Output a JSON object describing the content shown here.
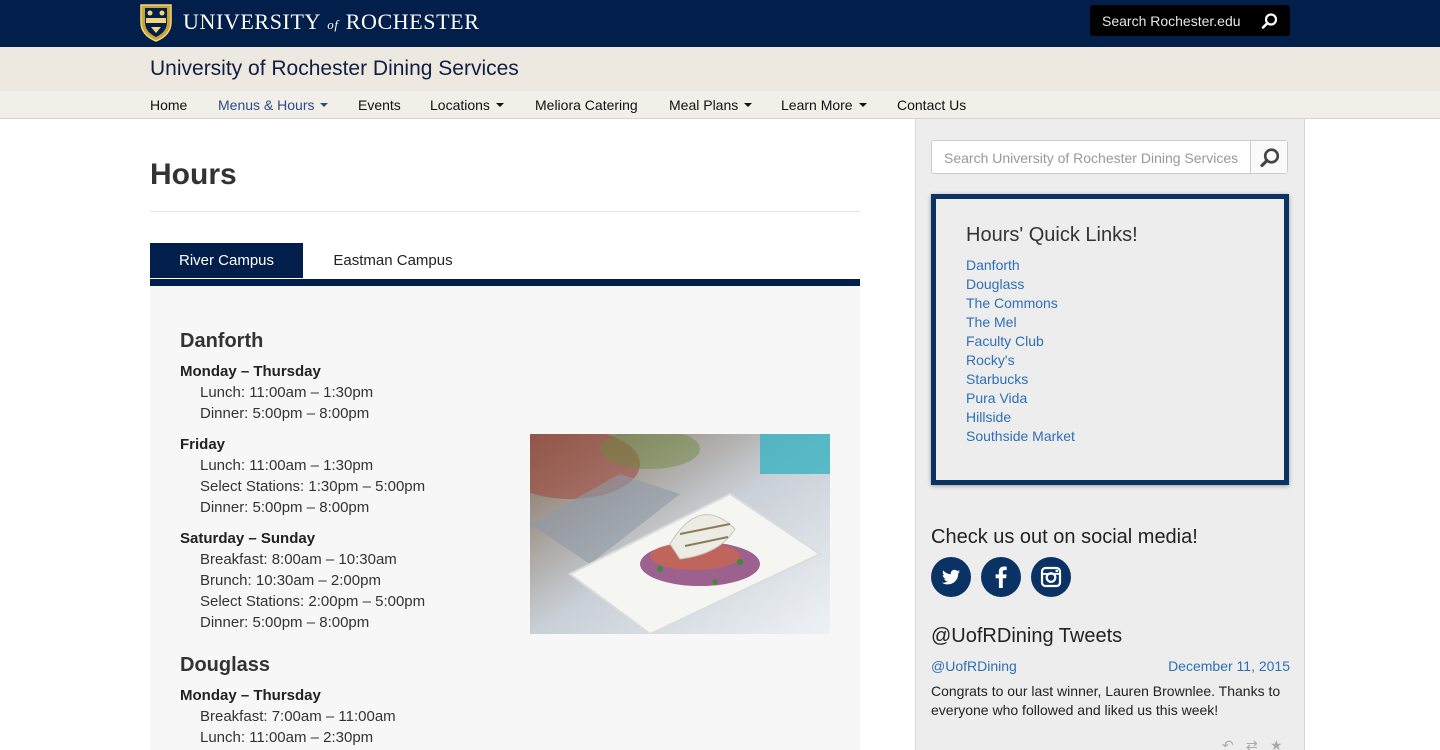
{
  "header": {
    "brand_main": "UNIVERSITY",
    "brand_of": "of",
    "brand_end": "ROCHESTER",
    "search_placeholder": "Search Rochester.edu"
  },
  "site_title": "University of Rochester Dining Services",
  "nav": {
    "items": [
      {
        "label": "Home",
        "dropdown": false,
        "active": false
      },
      {
        "label": "Menus & Hours",
        "dropdown": true,
        "active": true
      },
      {
        "label": "Events",
        "dropdown": false,
        "active": false
      },
      {
        "label": "Locations",
        "dropdown": true,
        "active": false
      },
      {
        "label": "Meliora Catering",
        "dropdown": false,
        "active": false
      },
      {
        "label": "Meal Plans",
        "dropdown": true,
        "active": false
      },
      {
        "label": "Learn More",
        "dropdown": true,
        "active": false
      },
      {
        "label": "Contact Us",
        "dropdown": false,
        "active": false
      }
    ]
  },
  "page": {
    "title": "Hours",
    "tabs": [
      {
        "label": "River Campus",
        "active": true
      },
      {
        "label": "Eastman Campus",
        "active": false
      }
    ]
  },
  "locations": [
    {
      "name": "Danforth",
      "schedule": [
        {
          "days": "Monday – Thursday",
          "meals": [
            "Lunch: 11:00am – 1:30pm",
            "Dinner: 5:00pm – 8:00pm"
          ]
        },
        {
          "days": "Friday",
          "meals": [
            "Lunch: 11:00am – 1:30pm",
            "Select Stations: 1:30pm – 5:00pm",
            "Dinner: 5:00pm – 8:00pm"
          ]
        },
        {
          "days": "Saturday – Sunday",
          "meals": [
            "Breakfast: 8:00am – 10:30am",
            "Brunch: 10:30am – 2:00pm",
            "Select Stations: 2:00pm – 5:00pm",
            "Dinner: 5:00pm – 8:00pm"
          ]
        }
      ]
    },
    {
      "name": "Douglass",
      "schedule": [
        {
          "days": "Monday – Thursday",
          "meals": [
            "Breakfast: 7:00am – 11:00am",
            "Lunch: 11:00am – 2:30pm"
          ]
        }
      ]
    }
  ],
  "sidebar": {
    "search_placeholder": "Search University of Rochester Dining Services",
    "quick_links_title": "Hours' Quick Links!",
    "quick_links": [
      "Danforth",
      "Douglass",
      "The Commons",
      "The Mel",
      "Faculty Club",
      "Rocky's",
      "Starbucks",
      "Pura Vida",
      "Hillside",
      "Southside Market"
    ],
    "social_title": "Check us out on social media!",
    "social_icons": [
      "twitter-icon",
      "facebook-icon",
      "instagram-icon"
    ],
    "tweets_title": "@UofRDining Tweets",
    "tweet": {
      "handle": "@UofRDining",
      "date": "December 11, 2015",
      "text": "Congrats to our last winner, Lauren Brownlee. Thanks to everyone who followed and liked us this week!"
    }
  },
  "colors": {
    "navy": "#021e4a",
    "link_blue": "#2f6fb5",
    "band_beige": "#ede8e0",
    "sidebar_gray": "#ededed"
  }
}
